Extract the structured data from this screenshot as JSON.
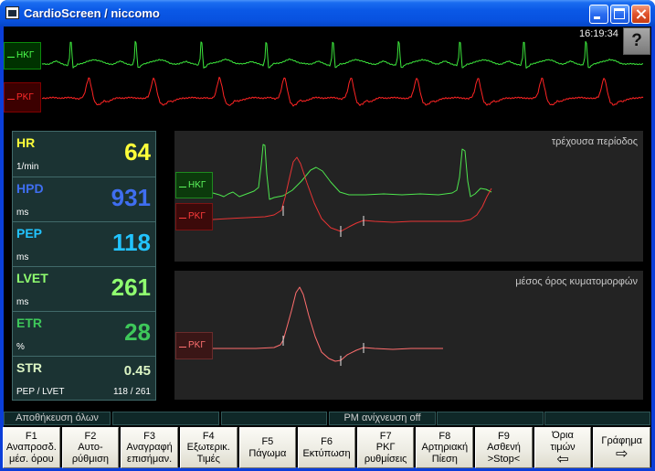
{
  "window": {
    "title": "CardioScreen / niccomo",
    "icon": "cardioscreen-app-icon",
    "controls": {
      "minimize": "minimize-icon",
      "maximize": "maximize-icon",
      "close": "close-icon"
    }
  },
  "clock": "16:19:34",
  "help": {
    "label": "?"
  },
  "live_strip": {
    "ecg_label": "ΗΚΓ",
    "icg_label": "ΡΚΓ",
    "ecg_color": "#3ce63c",
    "icg_color": "#ff2424"
  },
  "params": [
    {
      "name": "HR",
      "unit": "1/min",
      "value": "64",
      "color": "#ffff3a"
    },
    {
      "name": "HPD",
      "unit": "ms",
      "value": "931",
      "color": "#3f6ef0"
    },
    {
      "name": "PEP",
      "unit": "ms",
      "value": "118",
      "color": "#22c4ff"
    },
    {
      "name": "LVET",
      "unit": "ms",
      "value": "261",
      "color": "#90ff70"
    },
    {
      "name": "ETR",
      "unit": "%",
      "value": "28",
      "color": "#3ec85a"
    },
    {
      "name": "STR",
      "unit": "PEP / LVET",
      "value": "0.45",
      "detail": "118 / 261",
      "color": "#dcf5c4"
    }
  ],
  "current_period": {
    "title": "τρέχουσα περίοδος",
    "ecg_label": "ΗΚΓ",
    "icg_label": "ΡΚΓ",
    "ecg_color": "#4ee64e",
    "icg_color": "#e83434",
    "marker_color": "#e6e6e6"
  },
  "average": {
    "title": "μέσος όρος κυματομορφών",
    "icg_label": "ΡΚΓ",
    "icg_color": "#ff6e6e",
    "marker_color": "#e6e6e6"
  },
  "status_bar": {
    "save_all": "Αποθήκευση όλων",
    "pm_detection": "PM ανίχνευση off"
  },
  "function_keys": [
    {
      "key": "F1",
      "lines": [
        "Αναπροσδ.",
        "μέσ. όρου"
      ]
    },
    {
      "key": "F2",
      "lines": [
        "Αυτο-",
        "ρύθμιση"
      ]
    },
    {
      "key": "F3",
      "lines": [
        "Αναγραφή",
        "επισήμαν."
      ]
    },
    {
      "key": "F4",
      "lines": [
        "Εξωτερικ.",
        "Τιμές"
      ]
    },
    {
      "key": "F5",
      "lines": [
        "Πάγωμα"
      ]
    },
    {
      "key": "F6",
      "lines": [
        "Εκτύπωση"
      ]
    },
    {
      "key": "F7",
      "lines": [
        "ΡΚΓ",
        "ρυθμίσεις"
      ]
    },
    {
      "key": "F8",
      "lines": [
        "Αρτηριακή",
        "Πίεση"
      ]
    },
    {
      "key": "F9",
      "lines": [
        "Ασθενή",
        ">Stop<"
      ]
    },
    {
      "lines": [
        "Όρια",
        "τιμών"
      ],
      "icon": "arrow-left-icon"
    },
    {
      "lines": [
        "Γράφημα"
      ],
      "icon": "arrow-right-icon"
    }
  ]
}
